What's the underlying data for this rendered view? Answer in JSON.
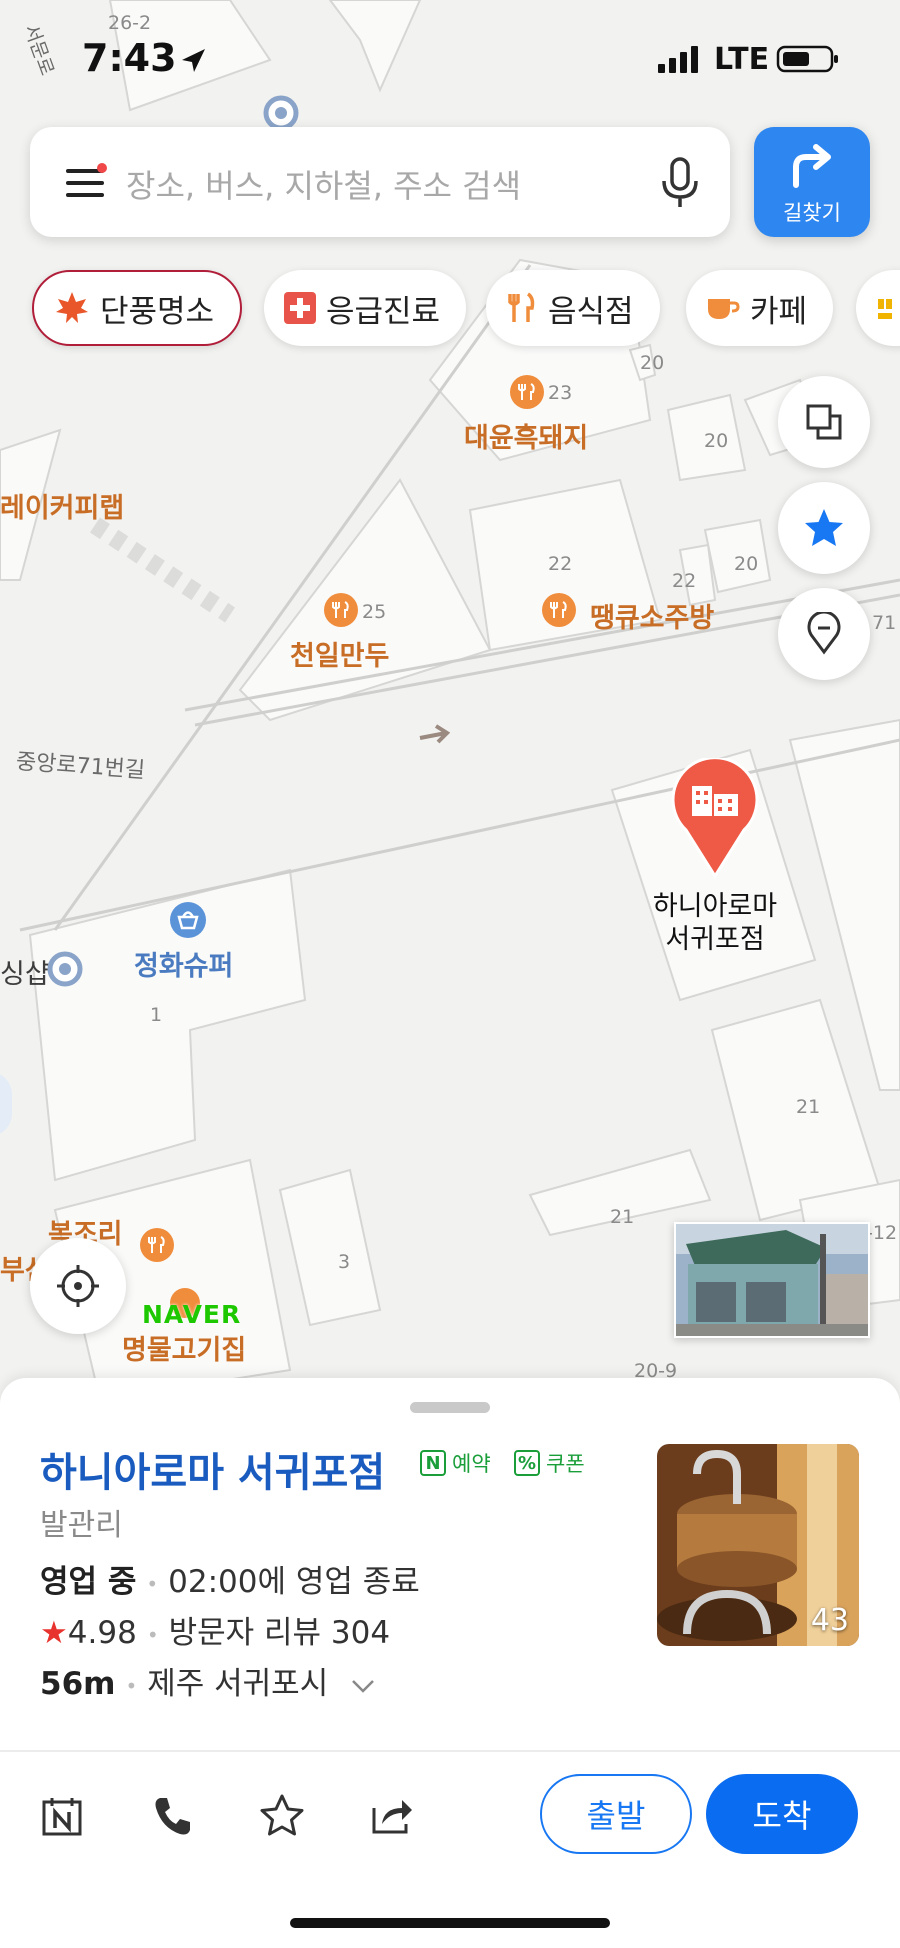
{
  "status_bar": {
    "time": "7:43",
    "network": "LTE"
  },
  "search": {
    "placeholder": "장소, 버스, 지하철, 주소 검색"
  },
  "directions_button": {
    "label": "길찾기"
  },
  "chips": [
    {
      "label": "단풍명소"
    },
    {
      "label": "응급진료"
    },
    {
      "label": "음식점"
    },
    {
      "label": "카페"
    }
  ],
  "map": {
    "pois": {
      "daeyun": "대윤흑돼지",
      "ttaengkyu": "땡큐소주방",
      "cheonil": "천일만두",
      "jeonghwa": "정화슈퍼",
      "myeongmul": "명물고기집",
      "bokjori": "복조리",
      "bakery": "레이커피랩",
      "left_edge_bu": "부산",
      "left_edge_shop": "싱샵",
      "selected_place": "하니아로마\n서귀포점"
    },
    "roads": {
      "jungang": "중앙로71번길",
      "seomun": "서문로"
    },
    "poi_numbers": {
      "daeyun": "23",
      "cheonil": "25"
    },
    "building_numbers": [
      "26-2",
      "20",
      "20",
      "22",
      "22",
      "20",
      "71",
      "1",
      "21",
      "21",
      "3",
      "20-9",
      "-12",
      "21"
    ],
    "brand_label": "NAVER"
  },
  "place": {
    "name": "하니아로마 서귀포점",
    "badges": [
      {
        "icon": "N",
        "label": "예약"
      },
      {
        "icon": "%",
        "label": "쿠폰"
      }
    ],
    "category": "발관리",
    "status": "영업 중",
    "hours": "02:00에 영업 종료",
    "rating": "4.98",
    "reviews": "방문자 리뷰 304",
    "distance": "56m",
    "address": "제주 서귀포시",
    "photo_count": "43"
  },
  "actions": {
    "depart": "출발",
    "arrive": "도착"
  },
  "colors": {
    "primary": "#0a6cf0",
    "name_blue": "#1a5bbf",
    "food_orange": "#c86d25",
    "marker_red": "#ee5a45",
    "badge_green": "#1a9e3a"
  }
}
